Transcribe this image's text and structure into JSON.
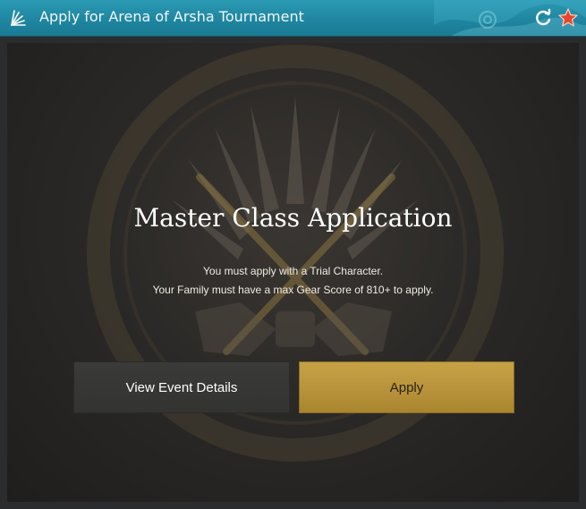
{
  "window": {
    "title": "Apply for Arena of Arsha Tournament",
    "title_icon": "menu-fan-icon",
    "controls": [
      "refresh-icon",
      "favorite-star-icon"
    ]
  },
  "main": {
    "heading": "Master Class Application",
    "description_line1": "You must apply with a Trial Character.",
    "description_line2": "Your Family must have a max Gear Score of 810+ to apply.",
    "buttons": {
      "details_label": "View Event Details",
      "apply_label": "Apply"
    }
  },
  "colors": {
    "titlebar": "#1f86a1",
    "apply_button": "#b8933b",
    "details_button": "#363634"
  }
}
